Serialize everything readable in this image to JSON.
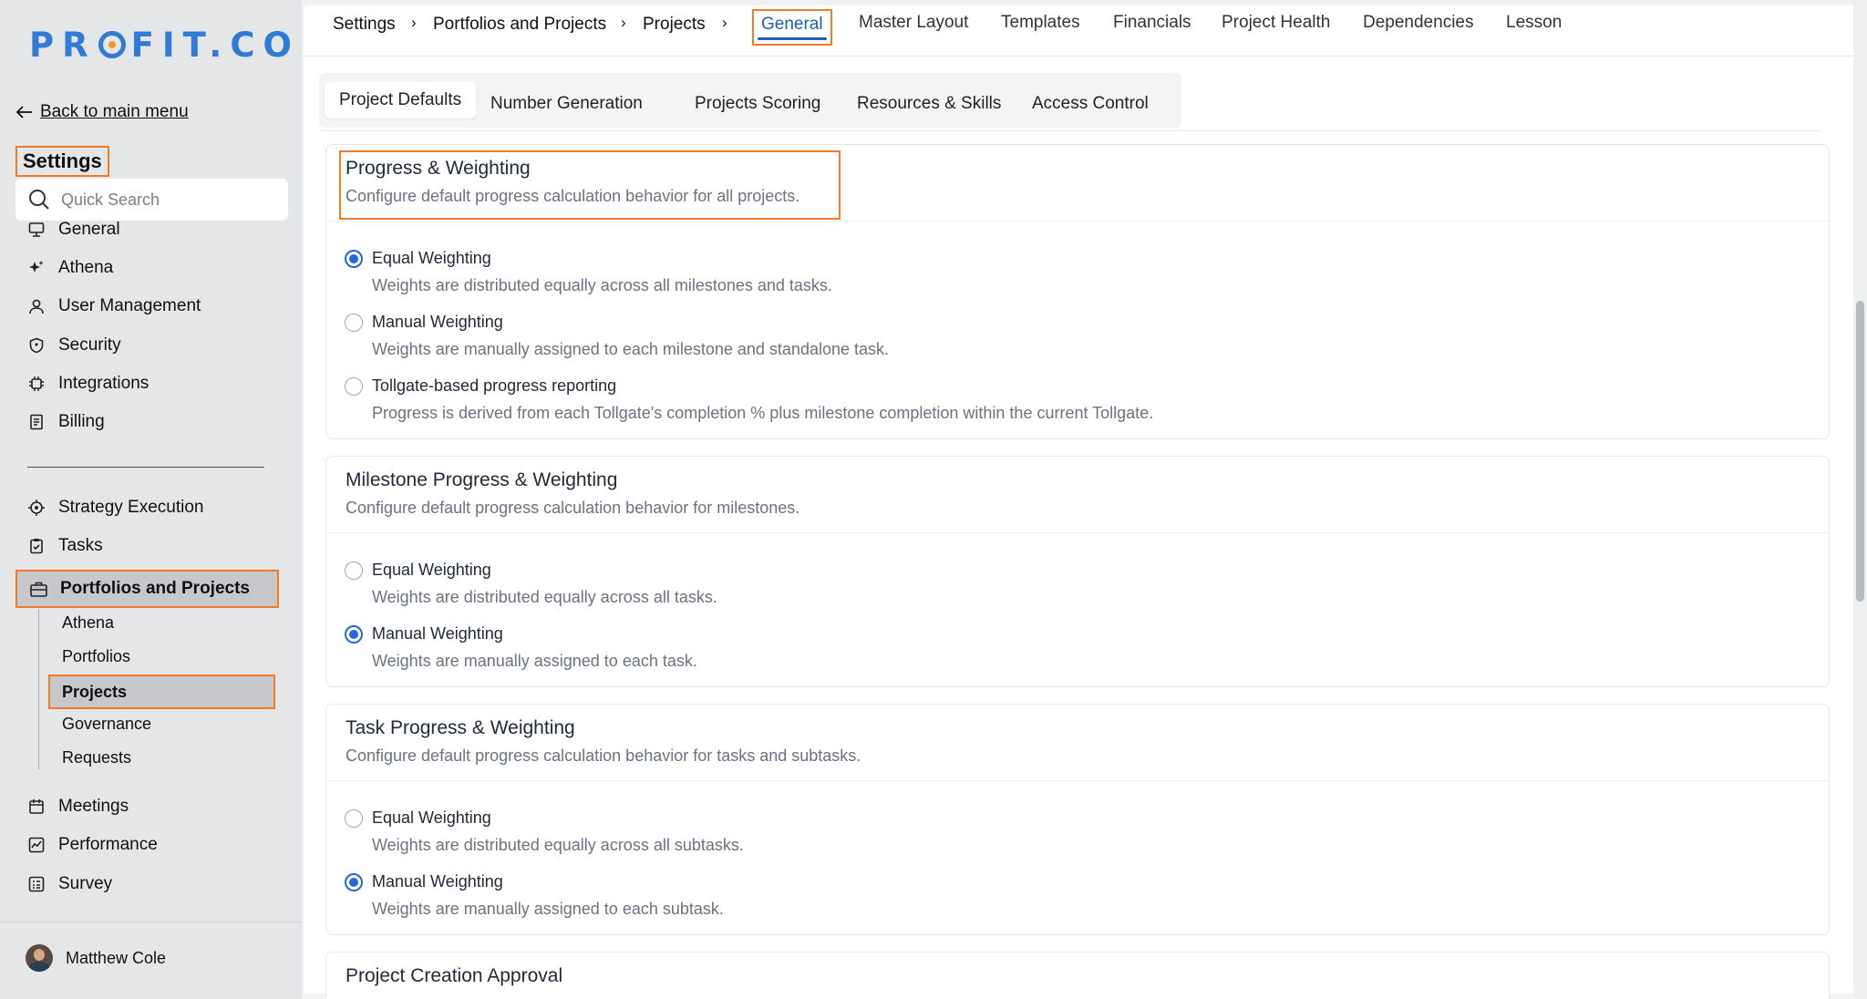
{
  "brand": {
    "logo_left": "PR",
    "logo_right": "FIT.CO"
  },
  "sidebar": {
    "back_label": "Back to main menu",
    "title": "Settings",
    "search_placeholder": "Quick Search",
    "items_top": [
      {
        "label": "General",
        "icon": "monitor-icon"
      },
      {
        "label": "Athena",
        "icon": "sparkle-icon"
      },
      {
        "label": "User Management",
        "icon": "user-icon"
      },
      {
        "label": "Security",
        "icon": "shield-icon"
      },
      {
        "label": "Integrations",
        "icon": "chip-icon"
      },
      {
        "label": "Billing",
        "icon": "receipt-icon"
      }
    ],
    "items_mid": [
      {
        "label": "Strategy Execution",
        "icon": "target-icon"
      },
      {
        "label": "Tasks",
        "icon": "clipboard-check-icon"
      }
    ],
    "portfolios": {
      "label": "Portfolios and Projects",
      "icon": "briefcase-icon"
    },
    "sub_items": [
      "Athena",
      "Portfolios",
      "Projects",
      "Governance",
      "Requests"
    ],
    "items_bottom": [
      {
        "label": "Meetings",
        "icon": "calendar-icon"
      },
      {
        "label": "Performance",
        "icon": "chart-icon"
      },
      {
        "label": "Survey",
        "icon": "survey-icon"
      }
    ],
    "user_name": "Matthew Cole"
  },
  "breadcrumb": [
    "Settings",
    "Portfolios and Projects",
    "Projects"
  ],
  "top_tabs": [
    "General",
    "Master Layout",
    "Templates",
    "Financials",
    "Project Health",
    "Dependencies",
    "Lesson"
  ],
  "sub_tabs": [
    "Project Defaults",
    "Number Generation",
    "Projects Scoring",
    "Resources & Skills",
    "Access Control"
  ],
  "sections": {
    "progress": {
      "title": "Progress & Weighting",
      "desc": "Configure default progress calculation behavior for all projects.",
      "options": [
        {
          "label": "Equal Weighting",
          "desc": "Weights are distributed equally across all milestones and tasks.",
          "selected": true
        },
        {
          "label": "Manual Weighting",
          "desc": "Weights are manually assigned to each milestone and standalone task.",
          "selected": false
        },
        {
          "label": "Tollgate-based progress reporting",
          "desc": "Progress is derived from each Tollgate's completion % plus milestone completion within the current Tollgate.",
          "selected": false
        }
      ]
    },
    "milestone": {
      "title": "Milestone Progress & Weighting",
      "desc": "Configure default progress calculation behavior for milestones.",
      "options": [
        {
          "label": "Equal Weighting",
          "desc": "Weights are distributed equally across all tasks.",
          "selected": false
        },
        {
          "label": "Manual Weighting",
          "desc": "Weights are manually assigned to each task.",
          "selected": true
        }
      ]
    },
    "task": {
      "title": "Task Progress & Weighting",
      "desc": "Configure default progress calculation behavior for tasks and subtasks.",
      "options": [
        {
          "label": "Equal Weighting",
          "desc": "Weights are distributed equally across all subtasks.",
          "selected": false
        },
        {
          "label": "Manual Weighting",
          "desc": "Weights are manually assigned to each subtask.",
          "selected": true
        }
      ]
    },
    "approval": {
      "title": "Project Creation Approval"
    }
  },
  "colors": {
    "accent": "#2563eb",
    "highlight": "#f07c2a",
    "brand": "#2f7bd6"
  }
}
